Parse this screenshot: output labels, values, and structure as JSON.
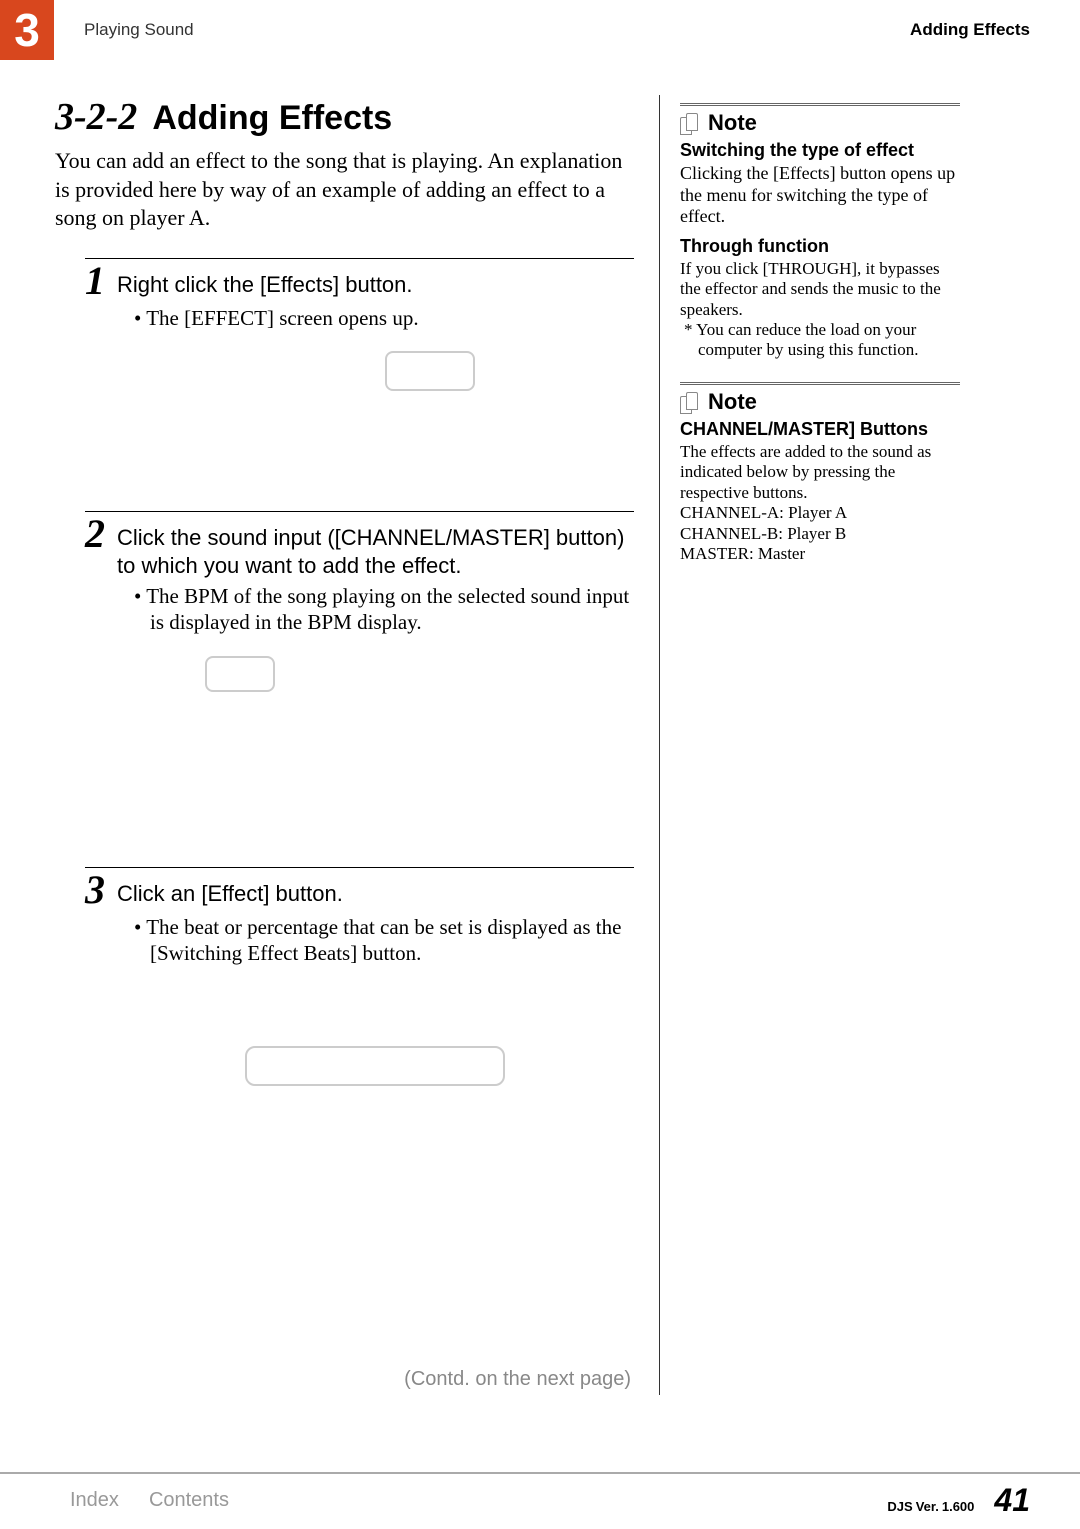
{
  "header": {
    "chapter_num": "3",
    "chapter_label": "Playing Sound",
    "right_label": "Adding Effects"
  },
  "section": {
    "num": "3-2-2",
    "title": "Adding Effects",
    "intro": "You can add an effect to the song that is playing. An explanation is provided here by way of an example of adding an effect to a song on player A."
  },
  "steps": [
    {
      "num": "1",
      "title": "Right click the [Effects] button.",
      "bullet": "The [EFFECT] screen opens up."
    },
    {
      "num": "2",
      "title": "Click the sound input ([CHANNEL/MASTER] button) to which you want to add the effect.",
      "bullet": "The BPM of the song playing on the selected sound input is displayed in the BPM display."
    },
    {
      "num": "3",
      "title": "Click an [Effect] button.",
      "bullet": "The beat or percentage that can be set is displayed as the [Switching Effect Beats] button."
    }
  ],
  "contd": "(Contd. on the next page)",
  "notes": [
    {
      "label": "Note",
      "items": [
        {
          "sub": "Switching the type of effect",
          "text": "Clicking the [Effects] button opens up the menu for switching the type of effect."
        },
        {
          "sub": "Through function",
          "text": "If you click [THROUGH], it bypasses the effector and sends the music to the speakers.",
          "bullet": "You can reduce the load on your computer by using this function."
        }
      ]
    },
    {
      "label": "Note",
      "items": [
        {
          "sub": "CHANNEL/MASTER] Buttons",
          "text": "The effects are added to the sound as indicated below by pressing the respective buttons.",
          "lines": [
            "CHANNEL-A: Player A",
            "CHANNEL-B: Player B",
            "MASTER: Master"
          ]
        }
      ]
    }
  ],
  "footer": {
    "index": "Index",
    "contents": "Contents",
    "product": "DJS",
    "ver_label": "Ver.",
    "ver": "1.600",
    "page": "41"
  }
}
